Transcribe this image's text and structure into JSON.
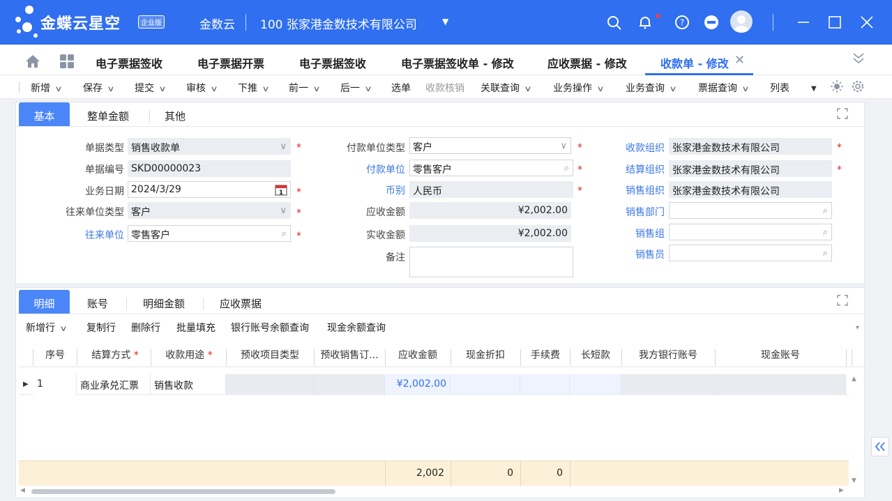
{
  "header": {
    "brand": "金蝶云星空",
    "brand_badge": "企业版",
    "tenant": "金数云",
    "company": "100  张家港金数技术有限公司",
    "colors": {
      "primary": "#2f6ff0",
      "notification": "#ff3b3b"
    },
    "icons": [
      "search-icon",
      "bell-icon",
      "help-icon",
      "minus-circle-icon",
      "avatar",
      "minimize-icon",
      "maximize-icon",
      "close-icon"
    ]
  },
  "tabs": [
    {
      "label": "电子票据签收"
    },
    {
      "label": "电子票据开票"
    },
    {
      "label": "电子票据签收"
    },
    {
      "label": "电子票据签收单 - 修改"
    },
    {
      "label": "应收票据 - 修改"
    },
    {
      "label": "收款单 - 修改",
      "active": true
    }
  ],
  "toolbar": {
    "new": "新增",
    "save": "保存",
    "submit": "提交",
    "audit": "审核",
    "push": "下推",
    "prev": "前一",
    "next": "后一",
    "select": "选单",
    "writeoff": "收款核销",
    "related": "关联查询",
    "biz_op": "业务操作",
    "biz_query": "业务查询",
    "bill_query": "票据查询",
    "list": "列表"
  },
  "header_panel": {
    "tabs": {
      "basic": "基本",
      "total_amount": "整单金额",
      "other": "其他"
    },
    "fields": {
      "bill_type_label": "单据类型",
      "bill_type": "销售收款单",
      "bill_no_label": "单据编号",
      "bill_no": "SKD00000023",
      "biz_date_label": "业务日期",
      "biz_date": "2024/3/29",
      "contact_type_label": "往来单位类型",
      "contact_type": "客户",
      "contact_label": "往来单位",
      "contact": "零售客户",
      "payer_type_label": "付款单位类型",
      "payer_type": "客户",
      "payer_label": "付款单位",
      "payer": "零售客户",
      "currency_label": "币别",
      "currency": "人民币",
      "receivable_label": "应收金额",
      "receivable": "¥2,002.00",
      "received_label": "实收金额",
      "received": "¥2,002.00",
      "remark_label": "备注",
      "remark": "",
      "recv_org_label": "收款组织",
      "recv_org": "张家港金数技术有限公司",
      "settle_org_label": "结算组织",
      "settle_org": "张家港金数技术有限公司",
      "sales_org_label": "销售组织",
      "sales_org": "张家港金数技术有限公司",
      "sales_dept_label": "销售部门",
      "sales_dept": "",
      "sales_group_label": "销售组",
      "sales_group": "",
      "salesman_label": "销售员",
      "salesman": "",
      "required_mark": "*"
    }
  },
  "detail_panel": {
    "tabs": {
      "detail": "明细",
      "account": "账号",
      "detail_amount": "明细金额",
      "bills": "应收票据"
    },
    "actions": {
      "add_row": "新增行",
      "copy_row": "复制行",
      "delete_row": "删除行",
      "batch_fill": "批量填充",
      "bank_balance": "银行账号余额查询",
      "cash_balance": "现金余额查询"
    },
    "columns": [
      "序号",
      "结算方式",
      "收款用途",
      "预收项目类型",
      "预收销售订...",
      "应收金额",
      "现金折扣",
      "手续费",
      "长短款",
      "我方银行账号",
      "现金账号"
    ],
    "rows": [
      {
        "seq": "1",
        "settle_method": "商业承兑汇票",
        "purpose": "销售收款",
        "amount": "¥2,002.00"
      }
    ],
    "totals": {
      "amount": "2,002",
      "discount": "0",
      "fee": "0"
    }
  }
}
